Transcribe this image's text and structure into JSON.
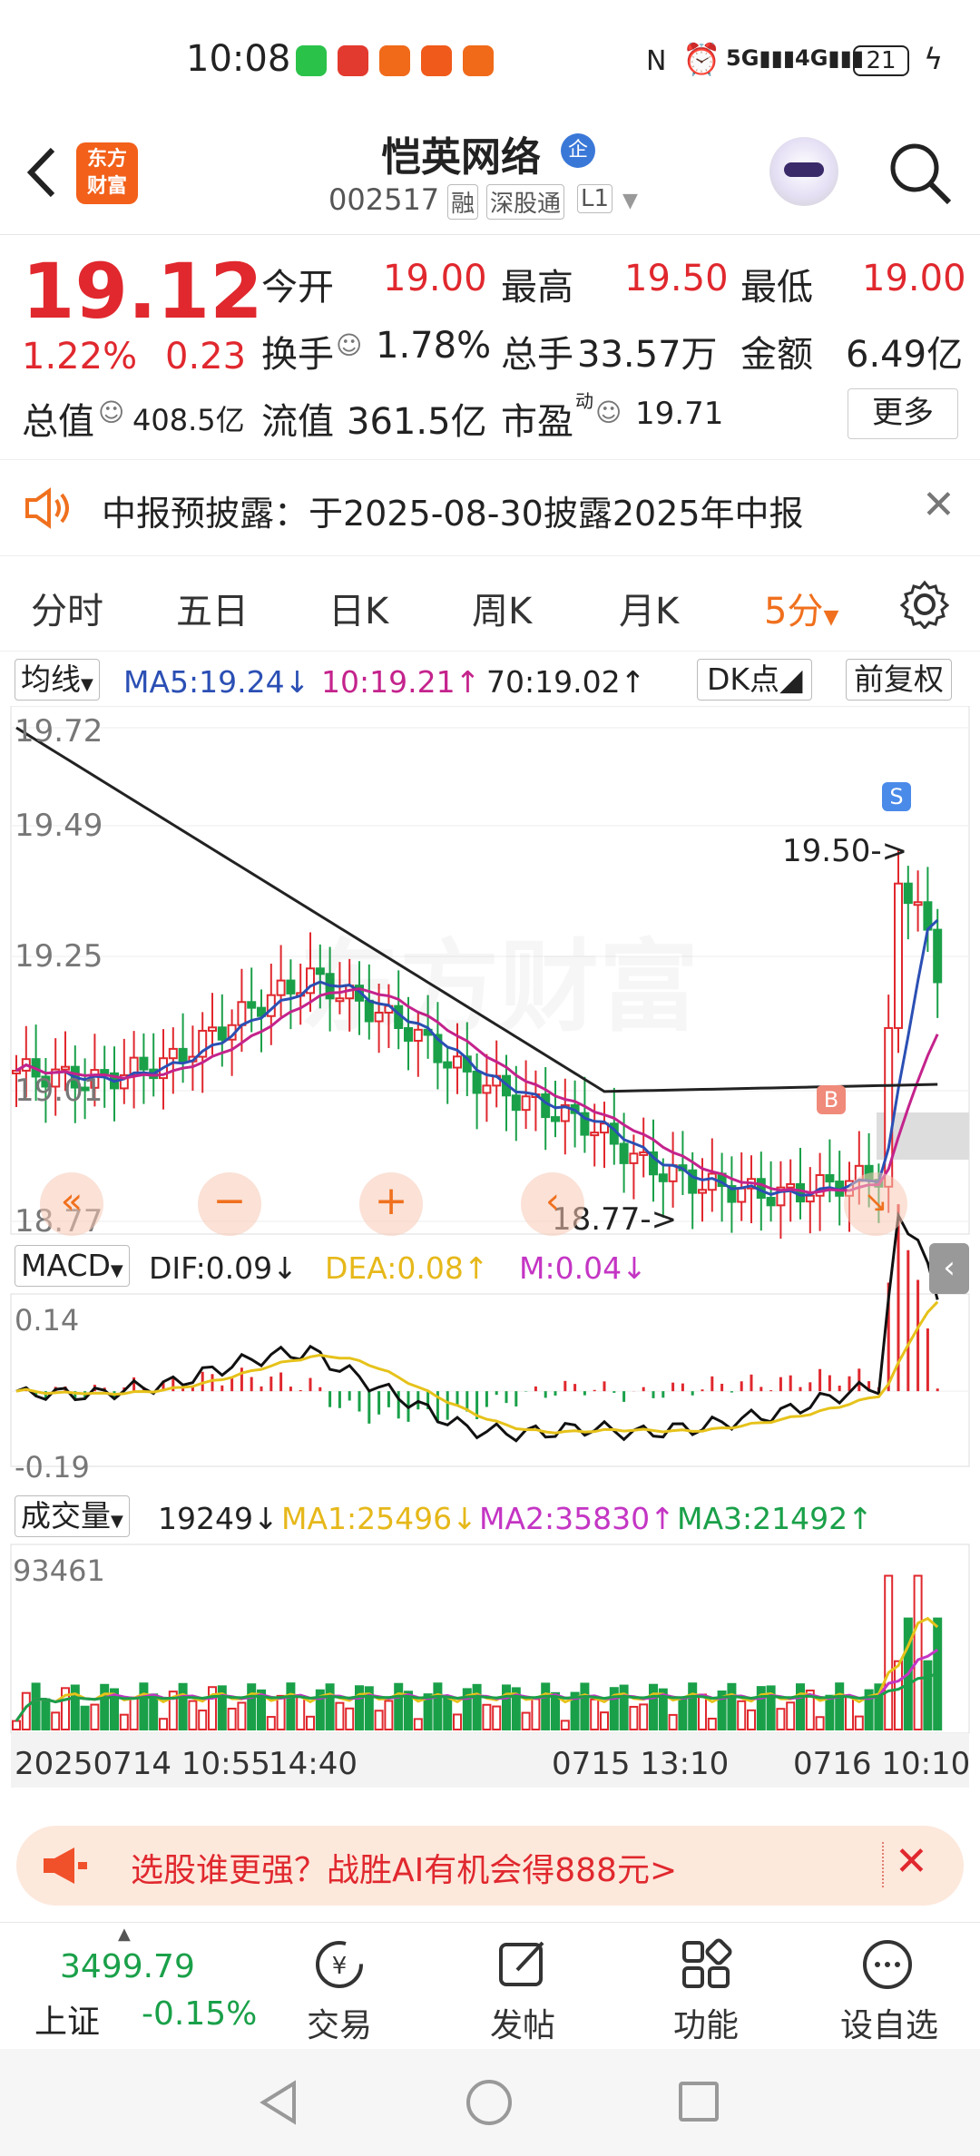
{
  "status_bar": {
    "time": "10:08",
    "network": "5G 4G",
    "battery": "21"
  },
  "header": {
    "stock_name": "恺英网络",
    "enterprise_badge": "企",
    "code": "002517",
    "tags": [
      "融",
      "深股通",
      "L1"
    ],
    "logo_text": [
      "东方",
      "财富"
    ],
    "icons": [
      "back-icon",
      "robot-assistant-icon",
      "search-icon"
    ]
  },
  "quote": {
    "price": "19.12",
    "change_pct": "1.22%",
    "change": "0.23",
    "open_label": "今开",
    "open": "19.00",
    "high_label": "最高",
    "high": "19.50",
    "low_label": "最低",
    "low": "19.00",
    "turnover_label": "换手",
    "turnover": "1.78%",
    "volume_label": "总手",
    "volume": "33.57万",
    "amount_label": "金额",
    "amount": "6.49亿",
    "mktcap_label": "总值",
    "mktcap": "408.5亿",
    "float_label": "流值",
    "float_cap": "361.5亿",
    "pe_label": "市盈",
    "pe_sup": "动",
    "pe": "19.71",
    "more_button": "更多"
  },
  "notice": {
    "text": "中报预披露：于2025-08-30披露2025年中报"
  },
  "tabs": [
    "分时",
    "五日",
    "日K",
    "周K",
    "月K",
    "5分"
  ],
  "active_tab": "5分",
  "ma_legend": {
    "type": "均线",
    "ma5": "MA5:19.24↓",
    "ma10": "10:19.21↑",
    "ma70": "70:19.02↑",
    "dk": "DK点",
    "adjust": "前复权"
  },
  "kline": {
    "y_labels": [
      "19.72",
      "19.49",
      "19.25",
      "19.01",
      "18.77"
    ],
    "high_marker": "19.50->",
    "low_marker": "18.77->",
    "buy_marker": "B",
    "sell_marker": "S",
    "watermark": "东方财富"
  },
  "macd_legend": {
    "type": "MACD",
    "dif": "DIF:0.09↓",
    "dea": "DEA:0.08↑",
    "m": "M:0.04↓",
    "y_top": "0.14",
    "y_bottom": "-0.19"
  },
  "vol_legend": {
    "type": "成交量",
    "vol": "19249↓",
    "ma1": "MA1:25496↓",
    "ma2": "MA2:35830↑",
    "ma3": "MA3:21492↑",
    "y_top": "93461"
  },
  "x_labels": [
    "20250714 10:55",
    "14:40",
    "0715 13:10",
    "0716 10:10"
  ],
  "ad": {
    "text": "选股谁更强？战胜AI有机会得888元>"
  },
  "bottom_nav": {
    "index_value": "3499.79",
    "index_name": "上证",
    "index_change": "-0.15%",
    "items": [
      "交易",
      "发帖",
      "功能",
      "设自选"
    ]
  },
  "colors": {
    "up": "#e0282e",
    "down": "#1aa049",
    "ma5": "#2b4fb4",
    "ma10": "#c4238c",
    "ma70": "#222222",
    "dea": "#e6c21a",
    "m": "#c435c4",
    "accent": "#f0701e"
  }
}
